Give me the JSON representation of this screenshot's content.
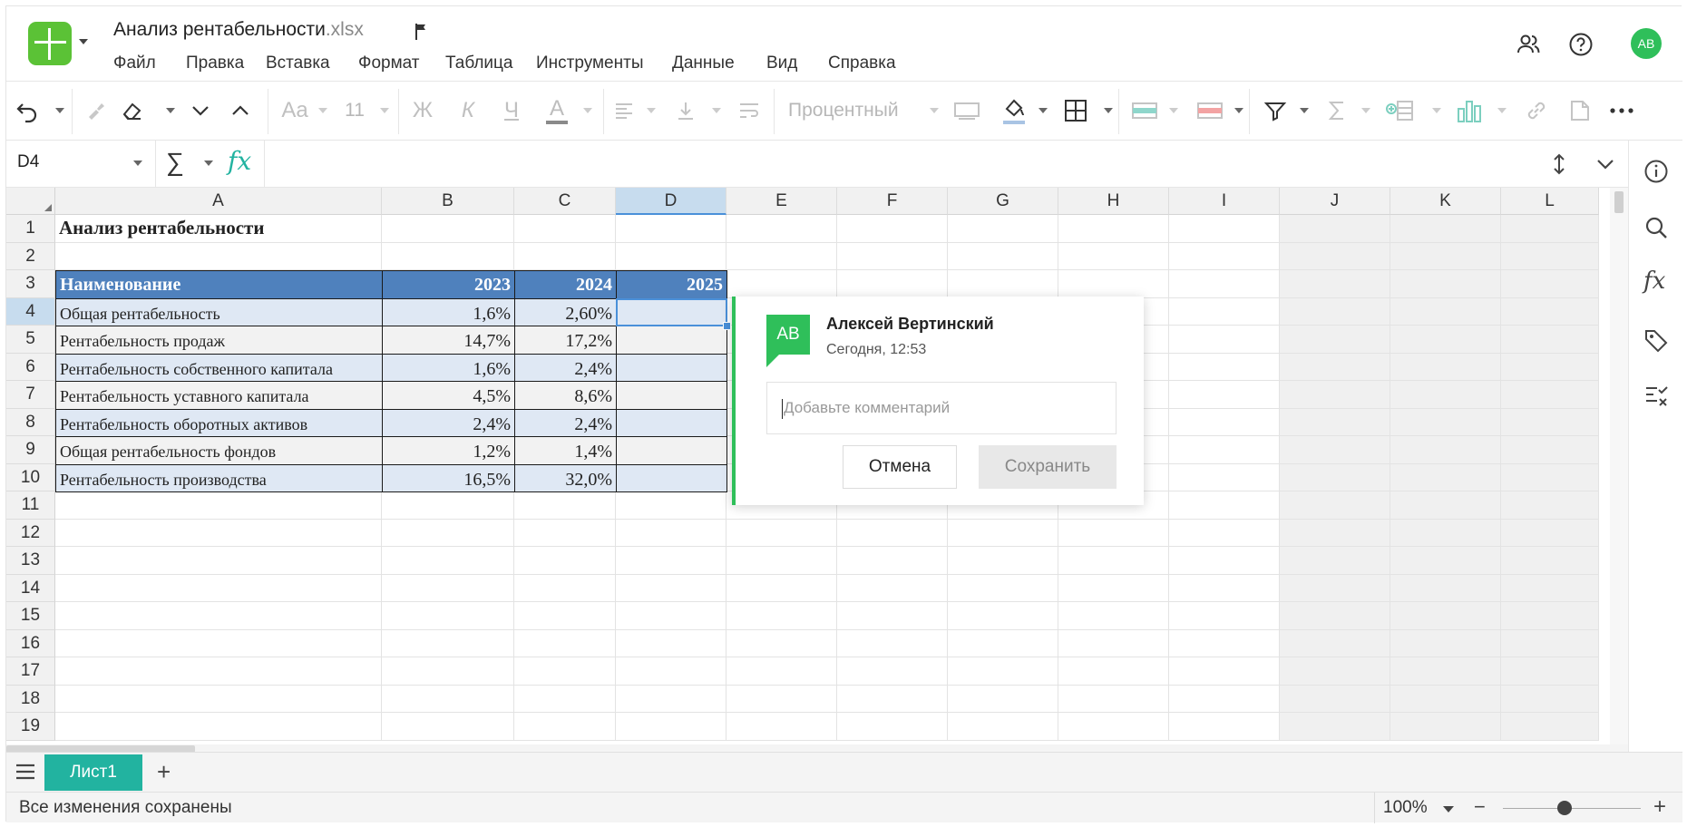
{
  "header": {
    "title": "Анализ рентабельности",
    "ext": ".xlsx",
    "menu": [
      "Файл",
      "Правка",
      "Вставка",
      "Формат",
      "Таблица",
      "Инструменты",
      "Данные",
      "Вид",
      "Справка"
    ],
    "avatar": "АВ"
  },
  "toolbar": {
    "font_size": "11",
    "number_format": "Процентный",
    "font_label": "Aa",
    "bold": "Ж",
    "italic": "К",
    "underline": "Ч",
    "font_color": "A"
  },
  "formula": {
    "name_box": "D4",
    "sum_symbol": "∑",
    "fx": "fx",
    "content": ""
  },
  "grid": {
    "columns": [
      "A",
      "B",
      "C",
      "D",
      "E",
      "F",
      "G",
      "H",
      "I",
      "J",
      "K",
      "L"
    ],
    "rows": [
      "1",
      "2",
      "3",
      "4",
      "5",
      "6",
      "7",
      "8",
      "9",
      "10",
      "11",
      "12",
      "13",
      "14",
      "15",
      "16",
      "17",
      "18",
      "19"
    ],
    "title": "Анализ рентабельности",
    "table_header": [
      "Наименование",
      "2023",
      "2024",
      "2025"
    ],
    "table_rows": [
      [
        "Общая рентабельность",
        "1,6%",
        "2,60%",
        ""
      ],
      [
        "Рентабельность продаж",
        "14,7%",
        "17,2%",
        ""
      ],
      [
        "Рентабельность собственного капитала",
        "1,6%",
        "2,4%",
        ""
      ],
      [
        "Рентабельность уставного капитала",
        "4,5%",
        "8,6%",
        ""
      ],
      [
        "Рентабельность оборотных активов",
        "2,4%",
        "2,4%",
        ""
      ],
      [
        "Общая рентабельность фондов",
        "1,2%",
        "1,4%",
        ""
      ],
      [
        "Рентабельность производства",
        "16,5%",
        "32,0%",
        ""
      ]
    ],
    "selected_cell": "D4"
  },
  "comment": {
    "avatar": "АВ",
    "author": "Алексей Вертинский",
    "time": "Сегодня, 12:53",
    "placeholder": "Добавьте комментарий",
    "cancel": "Отмена",
    "save": "Сохранить"
  },
  "sheets": {
    "tabs": [
      "Лист1"
    ],
    "add": "+"
  },
  "status": {
    "text": "Все изменения сохранены",
    "zoom": "100%",
    "zoom_fraction": 0.45,
    "minus": "−",
    "plus": "+"
  },
  "colors": {
    "accent": "#22b3a0",
    "brand": "#5bc236",
    "table_header": "#4f81bd",
    "row_even": "#dfe8f4",
    "selection": "#4a90d9",
    "avatar": "#2fbf5a"
  }
}
